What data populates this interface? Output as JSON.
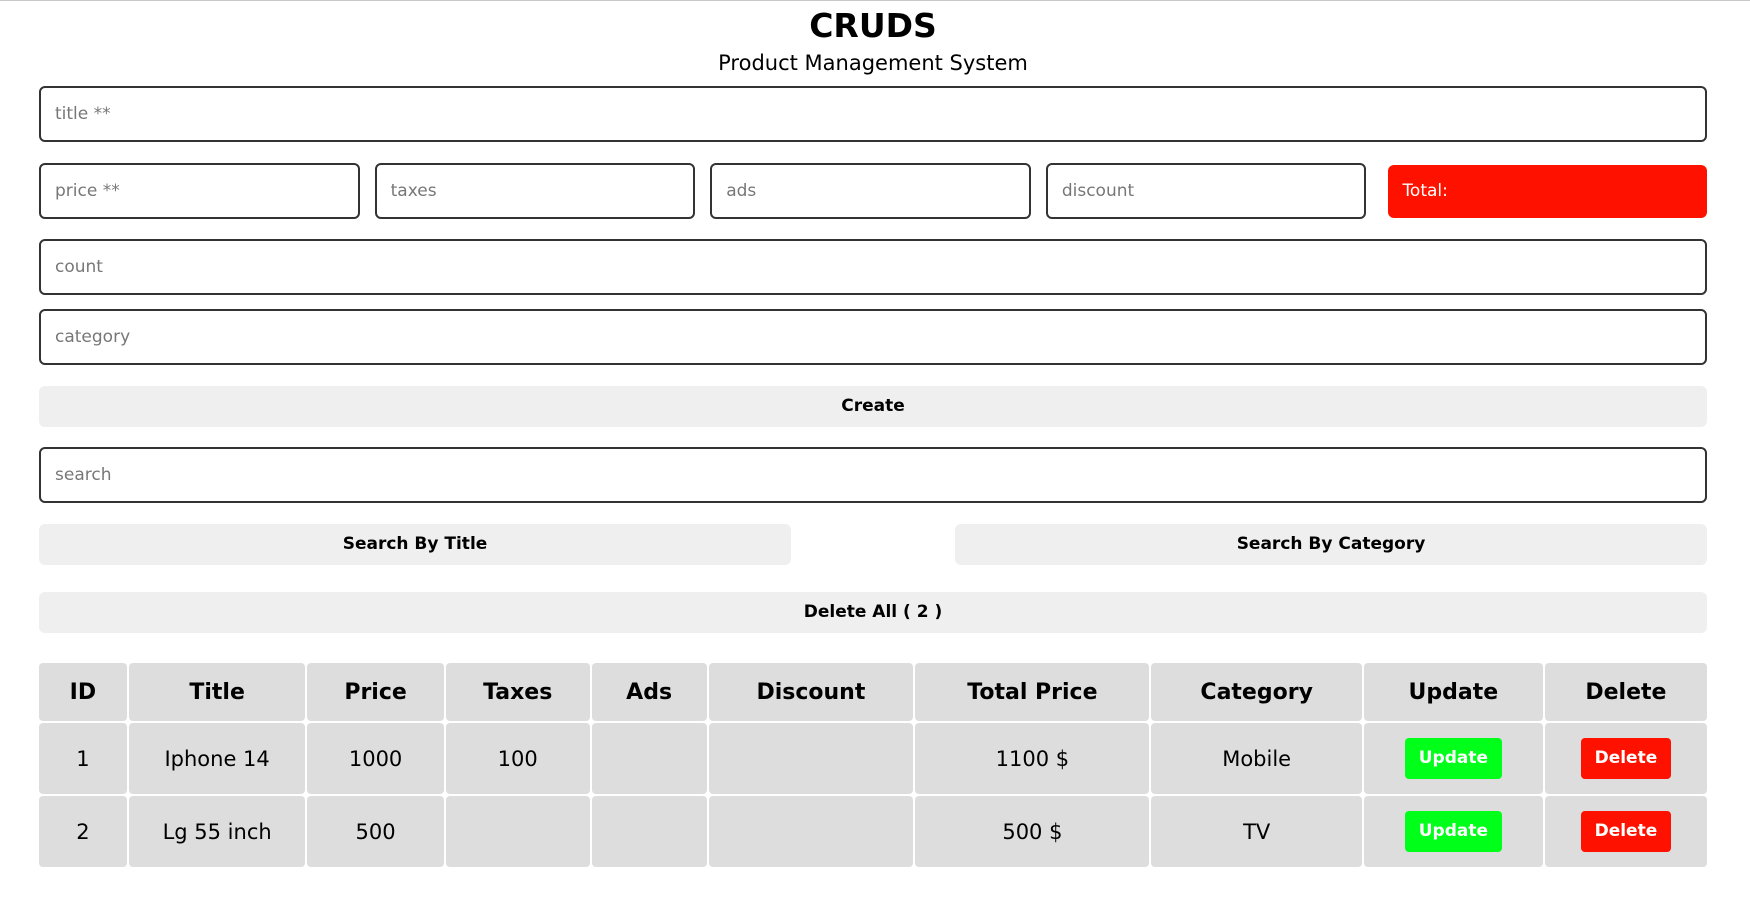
{
  "header": {
    "title": "CRUDS",
    "subtitle": "Product Management System"
  },
  "form": {
    "title_placeholder": "title **",
    "price_placeholder": "price **",
    "taxes_placeholder": "taxes",
    "ads_placeholder": "ads",
    "discount_placeholder": "discount",
    "total_label": "Total:",
    "count_placeholder": "count",
    "category_placeholder": "category",
    "create_label": "Create"
  },
  "search": {
    "placeholder": "search",
    "by_title_label": "Search By Title",
    "by_category_label": "Search By Category"
  },
  "delete_all_label": "Delete All ( 2 )",
  "colors": {
    "total_bg": "#ff1100",
    "update_btn": "#00ff19",
    "delete_btn": "#ff1100",
    "table_cell_bg": "#dddddd",
    "button_bg": "#efefef"
  },
  "table": {
    "headers": [
      "ID",
      "Title",
      "Price",
      "Taxes",
      "Ads",
      "Discount",
      "Total Price",
      "Category",
      "Update",
      "Delete"
    ],
    "update_label": "Update",
    "delete_label": "Delete",
    "rows": [
      {
        "id": "1",
        "title": "Iphone 14",
        "price": "1000",
        "taxes": "100",
        "ads": "",
        "discount": "",
        "total": "1100 $",
        "category": "Mobile"
      },
      {
        "id": "2",
        "title": "Lg 55 inch",
        "price": "500",
        "taxes": "",
        "ads": "",
        "discount": "",
        "total": "500 $",
        "category": "TV"
      }
    ]
  }
}
